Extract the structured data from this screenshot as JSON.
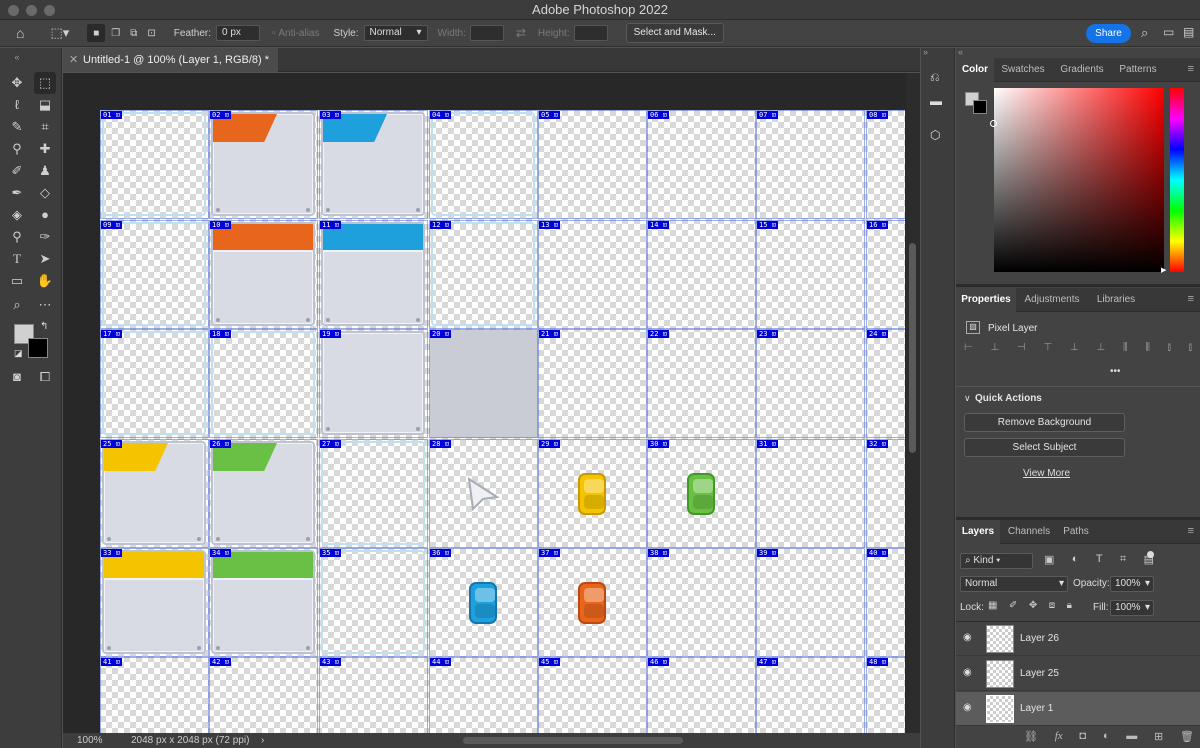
{
  "window": {
    "title": "Adobe Photoshop 2022"
  },
  "options": {
    "feather_label": "Feather:",
    "feather_value": "0 px",
    "antialias": "Anti-alias",
    "style_label": "Style:",
    "style_value": "Normal",
    "width_label": "Width:",
    "height_label": "Height:",
    "select_mask": "Select and Mask...",
    "share": "Share"
  },
  "document": {
    "tab": "Untitled-1 @ 100% (Layer 1, RGB/8) *",
    "zoom": "100%",
    "size": "2048 px x 2048 px (72 ppi)"
  },
  "slices": [
    "01",
    "02",
    "03",
    "04",
    "05",
    "06",
    "07",
    "08",
    "09",
    "10",
    "11",
    "12",
    "13",
    "14",
    "15",
    "16",
    "17",
    "18",
    "19",
    "20",
    "21",
    "22",
    "23",
    "24",
    "25",
    "26",
    "27",
    "28",
    "29",
    "30",
    "31",
    "32",
    "33",
    "34",
    "35",
    "36",
    "37",
    "38",
    "39",
    "40",
    "41",
    "42",
    "43",
    "44",
    "45",
    "46",
    "47",
    "48"
  ],
  "colors": {
    "orange": "#e8661c",
    "blue": "#1ea0dc",
    "yellow": "#f5c400",
    "green": "#6ac044",
    "accent": "#1473e6"
  },
  "color_panel": {
    "tabs": [
      "Color",
      "Swatches",
      "Gradients",
      "Patterns"
    ]
  },
  "properties": {
    "tabs": [
      "Properties",
      "Adjustments",
      "Libraries"
    ],
    "layer_type": "Pixel Layer",
    "more": "•••",
    "quick_actions": "Quick Actions",
    "remove_bg": "Remove Background",
    "select_subject": "Select Subject",
    "view_more": "View More"
  },
  "layers": {
    "tabs": [
      "Layers",
      "Channels",
      "Paths"
    ],
    "kind": "Kind",
    "blend": "Normal",
    "opacity_label": "Opacity:",
    "opacity": "100%",
    "lock_label": "Lock:",
    "fill_label": "Fill:",
    "fill": "100%",
    "items": [
      {
        "name": "Layer 26"
      },
      {
        "name": "Layer 25"
      },
      {
        "name": "Layer 1"
      }
    ]
  }
}
